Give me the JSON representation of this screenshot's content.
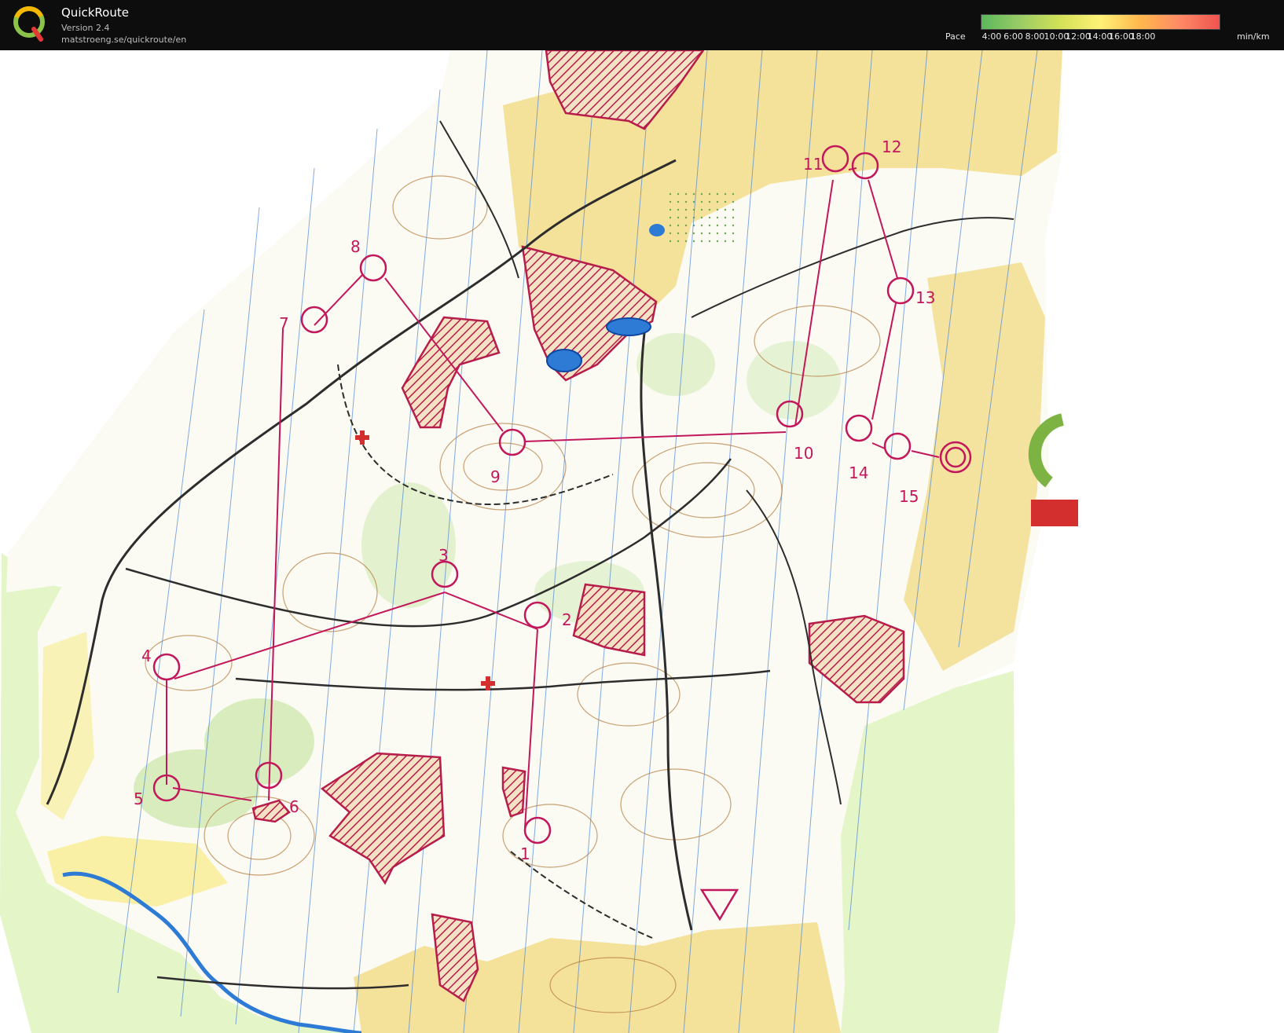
{
  "app": {
    "title": "QuickRoute",
    "version": "Version 2.4",
    "url": "matstroeng.se/quickroute/en"
  },
  "pace_legend": {
    "label": "Pace",
    "ticks": [
      "4:00",
      "6:00",
      "8:00",
      "10:00",
      "12:00",
      "14:00",
      "16:00",
      "18:00"
    ],
    "unit": "min/km",
    "colors": [
      "#5cb85c",
      "#9ccc65",
      "#d4e157",
      "#fff176",
      "#ffb74d",
      "#ff8a65",
      "#ef5350"
    ]
  },
  "map": {
    "control_numbers": [
      "1",
      "2",
      "3",
      "4",
      "5",
      "6",
      "7",
      "8",
      "9",
      "10",
      "11",
      "12",
      "13",
      "14",
      "15"
    ],
    "colors": {
      "paper": "#fbfbf4",
      "open_land": "#f2dc8a",
      "rough_open": "#f8ee9c",
      "green": "#d8ecbe",
      "overlay_green": "#e4f5c8",
      "course": "#c2185b",
      "out_of_bounds": "#b71c4a",
      "water": "#2e7bd6",
      "contour": "#b47a3c",
      "magnetic_north": "#4d86d8"
    }
  }
}
